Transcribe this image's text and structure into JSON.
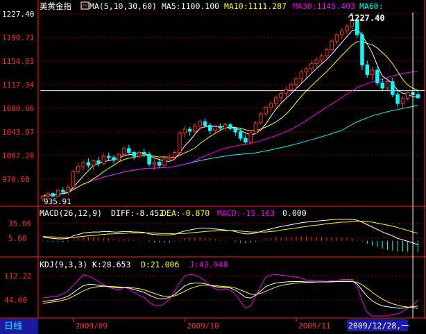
{
  "window": {
    "period_tab": "日线",
    "cursor_date_label": "2009/12/28,一"
  },
  "colors": {
    "up": "#ff3232",
    "down": "#00ffff",
    "ma5": "#ffffff",
    "ma10": "#ffff00",
    "ma30": "#ff00ff",
    "ma60": "#00ffff",
    "axis": "#ff2020",
    "grid": "#a00000"
  },
  "panels": {
    "price": {
      "symbol": "美黄金指",
      "ma_params": "MA(5,10,30,60)",
      "legend": [
        {
          "label": "MA5:1100.100",
          "color": "#ffffff"
        },
        {
          "label": "MA10:1111.287",
          "color": "#ffff00"
        },
        {
          "label": "MA30:1145.403",
          "color": "#ff00ff"
        },
        {
          "label": "MA60:",
          "color": "#00ffff"
        }
      ],
      "high_marker": "1227.40",
      "low_marker": "935.91",
      "y_ticks": [
        "1227.40",
        "1190.71",
        "1154.03",
        "1117.34",
        "1080.66",
        "1043.97",
        "1007.28",
        "970.60"
      ]
    },
    "macd": {
      "title": "MACD(26,12,9)",
      "legend": [
        {
          "label": "DIFF:-8.452",
          "color": "#ffffff"
        },
        {
          "label": "DEA:-0.870",
          "color": "#ffff00"
        },
        {
          "label": "MACD:-15.163",
          "color": "#ff00ff"
        },
        {
          "label": "0.000",
          "color": "#ffffff"
        }
      ],
      "y_ticks": [
        "35.66",
        "5.60"
      ]
    },
    "kdj": {
      "title": "KDJ(9,3,3)",
      "legend": [
        {
          "label": "K:28.653",
          "color": "#ffffff"
        },
        {
          "label": "D:21.006",
          "color": "#ffff00"
        },
        {
          "label": "J:43.948",
          "color": "#ff00ff"
        }
      ],
      "y_ticks": [
        "112.22",
        "44.60"
      ]
    }
  },
  "chart_data": {
    "type": "candlestick",
    "x_labels": [
      "2009/09",
      "2009/10",
      "2009/11",
      "2009/12/28,一"
    ],
    "price_y_ticks": [
      1227.4,
      1190.71,
      1154.03,
      1117.34,
      1080.66,
      1043.97,
      1007.28,
      970.6
    ],
    "price_range": [
      935.91,
      1227.4
    ],
    "reference_line": 1108,
    "candles": [
      [
        940,
        945,
        936,
        944
      ],
      [
        944,
        951,
        940,
        948
      ],
      [
        948,
        950,
        943,
        944
      ],
      [
        944,
        955,
        942,
        953
      ],
      [
        953,
        958,
        947,
        950
      ],
      [
        950,
        962,
        946,
        958
      ],
      [
        958,
        985,
        955,
        982
      ],
      [
        982,
        996,
        978,
        990
      ],
      [
        990,
        1000,
        984,
        996
      ],
      [
        996,
        1003,
        988,
        992
      ],
      [
        992,
        1000,
        985,
        999
      ],
      [
        999,
        1005,
        990,
        995
      ],
      [
        995,
        1010,
        992,
        1006
      ],
      [
        1006,
        1012,
        1000,
        1004
      ],
      [
        1004,
        1008,
        995,
        1000
      ],
      [
        1000,
        1011,
        996,
        1009
      ],
      [
        1009,
        1022,
        1005,
        1018
      ],
      [
        1018,
        1024,
        1008,
        1012
      ],
      [
        1012,
        1014,
        1001,
        1006
      ],
      [
        1006,
        1015,
        1003,
        1012
      ],
      [
        1012,
        1018,
        1005,
        1009
      ],
      [
        1009,
        1013,
        990,
        994
      ],
      [
        994,
        1002,
        985,
        997
      ],
      [
        997,
        1002,
        988,
        992
      ],
      [
        992,
        1004,
        990,
        1002
      ],
      [
        1002,
        1010,
        996,
        1005
      ],
      [
        1005,
        1015,
        1000,
        1012
      ],
      [
        1012,
        1045,
        1008,
        1042
      ],
      [
        1042,
        1053,
        1035,
        1048
      ],
      [
        1048,
        1052,
        1038,
        1045
      ],
      [
        1045,
        1057,
        1040,
        1053
      ],
      [
        1053,
        1063,
        1047,
        1060
      ],
      [
        1060,
        1065,
        1050,
        1054
      ],
      [
        1054,
        1058,
        1040,
        1046
      ],
      [
        1046,
        1055,
        1040,
        1052
      ],
      [
        1052,
        1057,
        1045,
        1050
      ],
      [
        1050,
        1058,
        1045,
        1055
      ],
      [
        1055,
        1058,
        1046,
        1049
      ],
      [
        1049,
        1052,
        1038,
        1044
      ],
      [
        1044,
        1050,
        1030,
        1034
      ],
      [
        1034,
        1040,
        1024,
        1028
      ],
      [
        1028,
        1044,
        1024,
        1042
      ],
      [
        1042,
        1060,
        1040,
        1058
      ],
      [
        1058,
        1075,
        1055,
        1072
      ],
      [
        1072,
        1085,
        1068,
        1082
      ],
      [
        1082,
        1092,
        1075,
        1088
      ],
      [
        1088,
        1100,
        1082,
        1097
      ],
      [
        1097,
        1108,
        1090,
        1104
      ],
      [
        1104,
        1115,
        1098,
        1110
      ],
      [
        1110,
        1122,
        1102,
        1118
      ],
      [
        1118,
        1130,
        1110,
        1127
      ],
      [
        1127,
        1140,
        1120,
        1137
      ],
      [
        1137,
        1145,
        1128,
        1142
      ],
      [
        1142,
        1155,
        1135,
        1150
      ],
      [
        1150,
        1160,
        1142,
        1156
      ],
      [
        1156,
        1166,
        1148,
        1162
      ],
      [
        1162,
        1175,
        1158,
        1172
      ],
      [
        1172,
        1188,
        1168,
        1185
      ],
      [
        1185,
        1198,
        1180,
        1195
      ],
      [
        1195,
        1205,
        1188,
        1201
      ],
      [
        1201,
        1212,
        1195,
        1208
      ],
      [
        1208,
        1227.4,
        1203,
        1218
      ],
      [
        1218,
        1222,
        1190,
        1195
      ],
      [
        1195,
        1200,
        1140,
        1148
      ],
      [
        1148,
        1155,
        1128,
        1133
      ],
      [
        1133,
        1145,
        1125,
        1140
      ],
      [
        1140,
        1145,
        1115,
        1120
      ],
      [
        1120,
        1128,
        1108,
        1112
      ],
      [
        1112,
        1125,
        1108,
        1122
      ],
      [
        1122,
        1128,
        1098,
        1102
      ],
      [
        1102,
        1108,
        1082,
        1088
      ],
      [
        1088,
        1100,
        1080,
        1096
      ],
      [
        1096,
        1108,
        1092,
        1105
      ],
      [
        1105,
        1112,
        1098,
        1102
      ],
      [
        1102,
        1110,
        1095,
        1097
      ]
    ],
    "macd": {
      "diff_range": [
        -30,
        45
      ],
      "diff": [
        8,
        6,
        5,
        4,
        4,
        5,
        10,
        13,
        16,
        17,
        18,
        18,
        19,
        19,
        18,
        18,
        19,
        19,
        18,
        18,
        17,
        14,
        13,
        12,
        12,
        12,
        13,
        17,
        20,
        22,
        24,
        26,
        26,
        25,
        24,
        23,
        22,
        21,
        19,
        16,
        14,
        14,
        16,
        19,
        22,
        24,
        27,
        29,
        31,
        33,
        35,
        37,
        38,
        39,
        40,
        41,
        42,
        43,
        44,
        44,
        44,
        44,
        42,
        38,
        33,
        28,
        23,
        18,
        14,
        10,
        5,
        2,
        -1,
        -4,
        -8
      ],
      "dea": [
        9,
        8,
        8,
        7,
        7,
        7,
        7,
        8,
        9,
        10,
        11,
        12,
        13,
        14,
        14,
        15,
        15,
        16,
        16,
        16,
        16,
        16,
        16,
        15,
        15,
        15,
        14,
        15,
        15,
        16,
        17,
        18,
        19,
        20,
        20,
        21,
        21,
        21,
        21,
        20,
        19,
        18,
        18,
        18,
        18,
        19,
        20,
        22,
        23,
        25,
        26,
        28,
        29,
        31,
        32,
        33,
        35,
        36,
        37,
        38,
        38,
        39,
        40,
        40,
        39,
        38,
        36,
        34,
        32,
        30,
        27,
        24,
        21,
        18,
        15
      ],
      "bars": [
        -2,
        -4,
        -6,
        -6,
        -6,
        -4,
        6,
        10,
        14,
        14,
        14,
        12,
        12,
        10,
        8,
        6,
        8,
        6,
        4,
        4,
        2,
        -4,
        -6,
        -6,
        -6,
        -6,
        -2,
        4,
        10,
        12,
        14,
        16,
        14,
        10,
        8,
        4,
        2,
        0,
        -4,
        -8,
        -10,
        -8,
        -4,
        2,
        8,
        10,
        14,
        14,
        16,
        16,
        18,
        18,
        18,
        16,
        16,
        16,
        14,
        14,
        14,
        12,
        12,
        10,
        4,
        -4,
        -12,
        -20,
        -26,
        -32,
        -36,
        -40,
        -44,
        -44,
        -44,
        -44,
        -46
      ]
    },
    "kdj": {
      "range": [
        0,
        130
      ],
      "k": [
        40,
        42,
        44,
        46,
        50,
        55,
        65,
        75,
        85,
        88,
        88,
        86,
        84,
        82,
        80,
        78,
        80,
        78,
        74,
        70,
        66,
        58,
        52,
        48,
        48,
        52,
        60,
        72,
        84,
        90,
        92,
        92,
        90,
        86,
        82,
        80,
        80,
        78,
        72,
        62,
        52,
        50,
        58,
        70,
        82,
        88,
        92,
        94,
        95,
        96,
        96,
        96,
        95,
        95,
        95,
        95,
        95,
        96,
        96,
        97,
        97,
        97,
        90,
        72,
        55,
        42,
        34,
        28,
        26,
        24,
        22,
        22,
        24,
        26,
        28
      ],
      "d": [
        35,
        37,
        39,
        41,
        44,
        48,
        55,
        62,
        70,
        76,
        80,
        82,
        83,
        83,
        82,
        81,
        80,
        80,
        78,
        76,
        73,
        68,
        63,
        58,
        55,
        54,
        56,
        62,
        69,
        76,
        81,
        85,
        86,
        86,
        85,
        83,
        82,
        81,
        78,
        73,
        67,
        61,
        60,
        63,
        69,
        75,
        81,
        85,
        88,
        90,
        92,
        93,
        94,
        94,
        95,
        95,
        95,
        95,
        96,
        96,
        96,
        96,
        94,
        87,
        77,
        66,
        56,
        47,
        40,
        34,
        30,
        27,
        25,
        24,
        21
      ],
      "j": [
        50,
        52,
        54,
        56,
        62,
        70,
        85,
        100,
        115,
        112,
        105,
        96,
        88,
        80,
        76,
        72,
        80,
        75,
        66,
        58,
        52,
        38,
        30,
        28,
        34,
        48,
        68,
        92,
        112,
        116,
        114,
        108,
        98,
        86,
        76,
        72,
        76,
        72,
        60,
        40,
        22,
        28,
        54,
        84,
        108,
        114,
        116,
        114,
        112,
        110,
        108,
        106,
        100,
        100,
        98,
        98,
        96,
        100,
        98,
        102,
        102,
        102,
        84,
        42,
        10,
        0,
        0,
        0,
        0,
        4,
        6,
        12,
        22,
        30,
        44
      ]
    }
  }
}
